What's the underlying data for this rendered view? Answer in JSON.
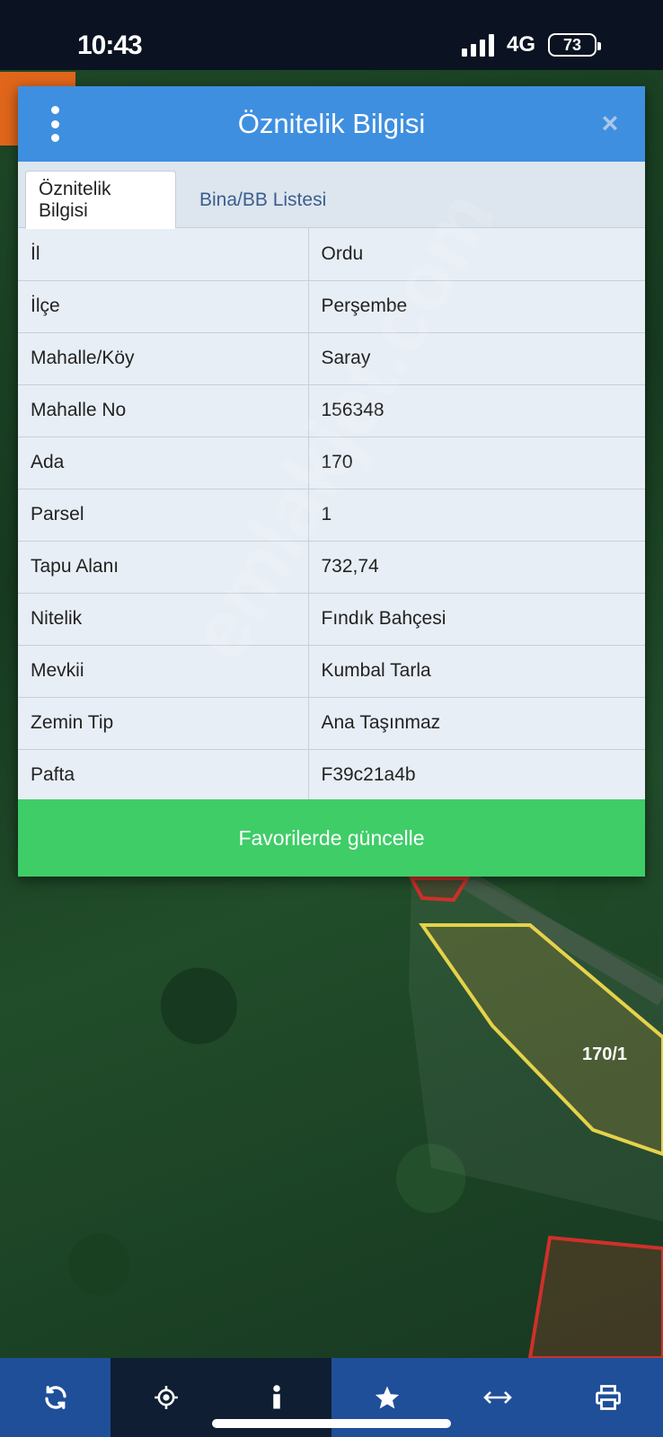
{
  "status_bar": {
    "time": "10:43",
    "network": "4G",
    "battery": "73"
  },
  "dialog": {
    "title": "Öznitelik Bilgisi",
    "tabs": [
      {
        "label": "Öznitelik Bilgisi"
      },
      {
        "label": "Bina/BB Listesi"
      }
    ],
    "rows": [
      {
        "key": "İl",
        "value": "Ordu"
      },
      {
        "key": "İlçe",
        "value": "Perşembe"
      },
      {
        "key": "Mahalle/Köy",
        "value": "Saray"
      },
      {
        "key": "Mahalle No",
        "value": "156348"
      },
      {
        "key": "Ada",
        "value": "170"
      },
      {
        "key": "Parsel",
        "value": "1"
      },
      {
        "key": "Tapu Alanı",
        "value": "732,74"
      },
      {
        "key": "Nitelik",
        "value": "Fındık Bahçesi"
      },
      {
        "key": "Mevkii",
        "value": "Kumbal Tarla"
      },
      {
        "key": "Zemin Tip",
        "value": "Ana Taşınmaz"
      },
      {
        "key": "Pafta",
        "value": "F39c21a4b"
      }
    ],
    "update_button": "Favorilerde güncelle",
    "close_icon": "close-icon",
    "menu_icon": "kebab-menu-icon"
  },
  "map": {
    "parcel_label": "170/1",
    "parcel_color": "#e6d24a",
    "neighbor_color": "#d0302a"
  },
  "watermark": "emlakjet.com",
  "toolbar": {
    "items": [
      {
        "icon": "refresh-icon"
      },
      {
        "icon": "crosshair-icon"
      },
      {
        "icon": "info-icon"
      },
      {
        "icon": "star-icon"
      },
      {
        "icon": "measure-arrows-icon"
      },
      {
        "icon": "print-icon"
      }
    ]
  }
}
